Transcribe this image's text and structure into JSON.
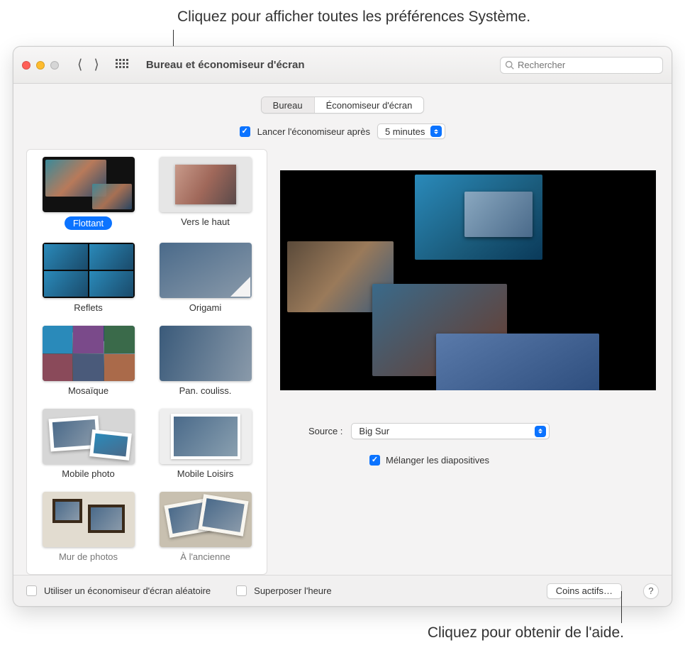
{
  "callouts": {
    "top": "Cliquez pour afficher toutes les préférences Système.",
    "bottom": "Cliquez pour obtenir de l'aide."
  },
  "titlebar": {
    "title": "Bureau et économiseur d'écran",
    "search_placeholder": "Rechercher"
  },
  "tabs": {
    "desktop": "Bureau",
    "screensaver": "Économiseur d'écran"
  },
  "start_after": {
    "checkbox_label": "Lancer l'économiseur après",
    "checked": true,
    "value": "5 minutes"
  },
  "savers": [
    {
      "label": "Flottant",
      "selected": true,
      "style": "floating"
    },
    {
      "label": "Vers le haut",
      "selected": false,
      "style": "shift"
    },
    {
      "label": "Reflets",
      "selected": false,
      "style": "reflections"
    },
    {
      "label": "Origami",
      "selected": false,
      "style": "origami"
    },
    {
      "label": "Mosaïque",
      "selected": false,
      "style": "mosaic"
    },
    {
      "label": "Pan. couliss.",
      "selected": false,
      "style": "pan"
    },
    {
      "label": "Mobile photo",
      "selected": false,
      "style": "photomobile"
    },
    {
      "label": "Mobile Loisirs",
      "selected": false,
      "style": "leisure"
    },
    {
      "label": "Mur de photos",
      "selected": false,
      "style": "wall"
    },
    {
      "label": "À l'ancienne",
      "selected": false,
      "style": "vintage"
    }
  ],
  "source": {
    "label": "Source :",
    "value": "Big Sur"
  },
  "shuffle": {
    "label": "Mélanger les diapositives",
    "checked": true
  },
  "bottom": {
    "random_label": "Utiliser un économiseur d'écran aléatoire",
    "random_checked": false,
    "overlay_label": "Superposer l'heure",
    "overlay_checked": false,
    "hotcorners": "Coins actifs…",
    "help": "?"
  }
}
